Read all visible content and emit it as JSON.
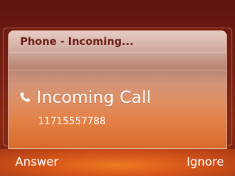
{
  "dialog": {
    "title": "Phone - Incoming...",
    "call_title": "Incoming Call",
    "caller_number": "11715557788",
    "call_icon": "phone-icon"
  },
  "softkeys": {
    "left_label": "Answer",
    "right_label": "Ignore"
  }
}
